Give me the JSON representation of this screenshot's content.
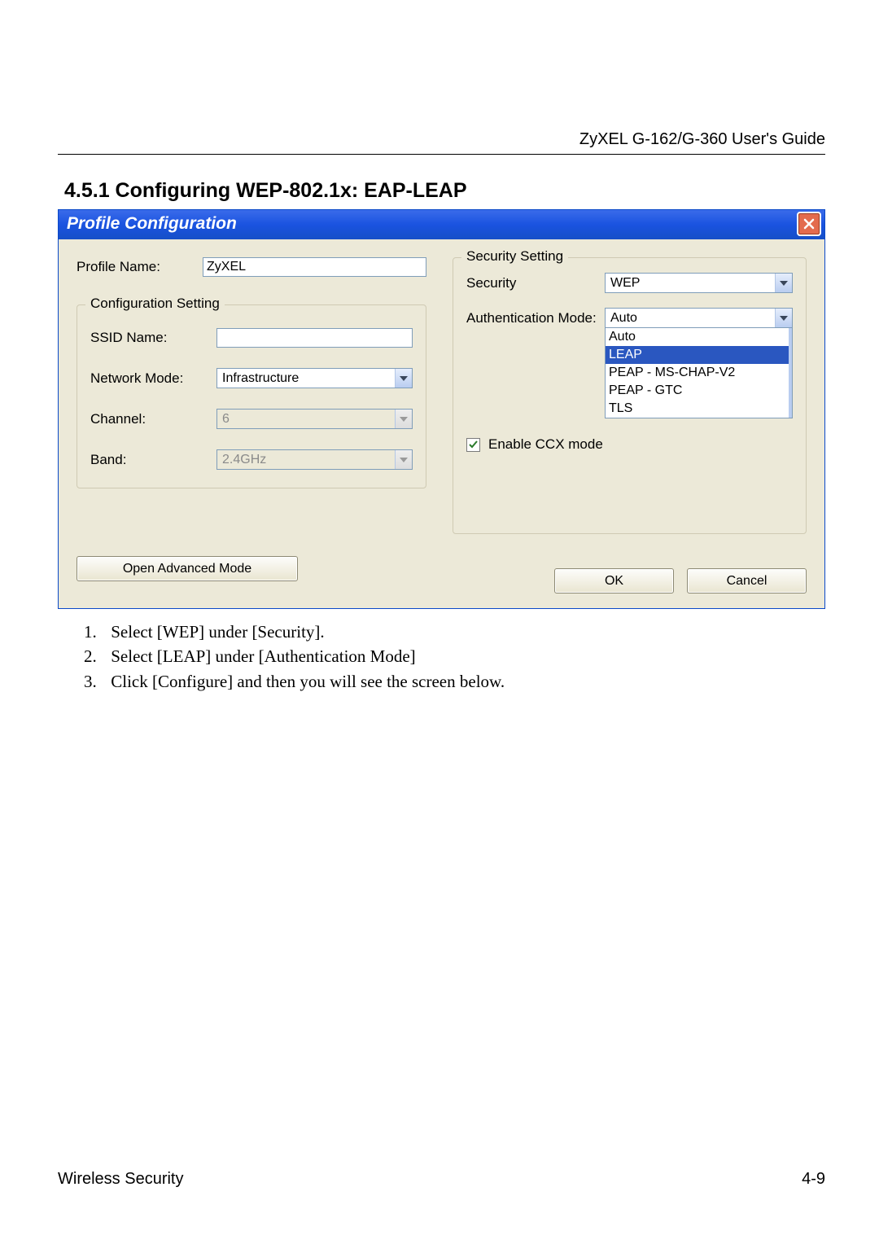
{
  "header": {
    "doc_title": "ZyXEL G-162/G-360 User's Guide"
  },
  "section": {
    "heading": "4.5.1   Configuring WEP-802.1x: EAP-LEAP"
  },
  "window": {
    "title": "Profile Configuration",
    "left": {
      "profile_name_label": "Profile Name:",
      "profile_name_value": "ZyXEL",
      "config_group_label": "Configuration Setting",
      "ssid_label": "SSID Name:",
      "ssid_value": "",
      "network_mode_label": "Network Mode:",
      "network_mode_value": "Infrastructure",
      "channel_label": "Channel:",
      "channel_value": "6",
      "band_label": "Band:",
      "band_value": "2.4GHz"
    },
    "right": {
      "group_label": "Security Setting",
      "security_label": "Security",
      "security_value": "WEP",
      "auth_label": "Authentication Mode:",
      "auth_value": "Auto",
      "auth_options": [
        "Auto",
        "LEAP",
        "PEAP - MS-CHAP-V2",
        "PEAP - GTC",
        "TLS"
      ],
      "auth_selected_index": 1,
      "enable_ccx_label": "Enable CCX mode",
      "enable_ccx_checked": true
    },
    "buttons": {
      "advanced": "Open Advanced Mode",
      "ok": "OK",
      "cancel": "Cancel"
    }
  },
  "instructions": [
    "Select [WEP] under [Security].",
    "Select [LEAP] under [Authentication Mode]",
    "Click [Configure] and then you will see the screen below."
  ],
  "footer": {
    "left": "Wireless Security",
    "right": "4-9"
  }
}
